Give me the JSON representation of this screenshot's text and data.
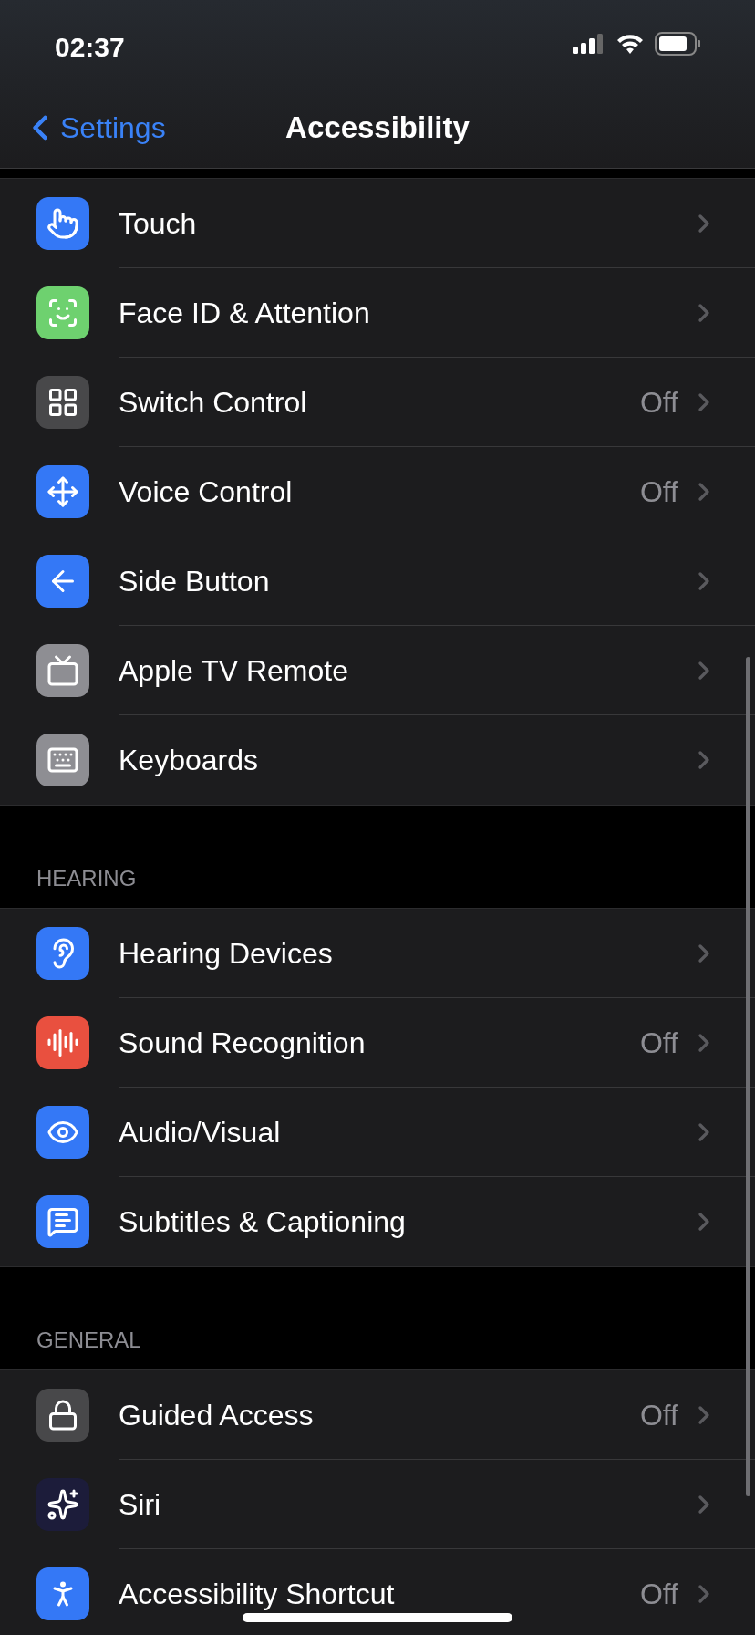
{
  "status_bar": {
    "time": "02:37"
  },
  "nav": {
    "back": "Settings",
    "title": "Accessibility"
  },
  "sections": [
    {
      "items": [
        {
          "label": "Touch",
          "color": "#3478f6"
        },
        {
          "label": "Face ID & Attention",
          "color": "#6ed16f"
        },
        {
          "label": "Switch Control",
          "value": "Off",
          "color": "#48484a"
        },
        {
          "label": "Voice Control",
          "value": "Off",
          "color": "#3478f6"
        },
        {
          "label": "Side Button",
          "color": "#3478f6"
        },
        {
          "label": "Apple TV Remote",
          "color": "#8e8e93"
        },
        {
          "label": "Keyboards",
          "color": "#8e8e93"
        }
      ]
    },
    {
      "header": "HEARING",
      "items": [
        {
          "label": "Hearing Devices",
          "color": "#3478f6"
        },
        {
          "label": "Sound Recognition",
          "value": "Off",
          "color": "#e9503f"
        },
        {
          "label": "Audio/Visual",
          "color": "#3478f6"
        },
        {
          "label": "Subtitles & Captioning",
          "color": "#3478f6"
        }
      ]
    },
    {
      "header": "GENERAL",
      "items": [
        {
          "label": "Guided Access",
          "value": "Off",
          "color": "#48484a"
        },
        {
          "label": "Siri",
          "color": "#1c1c3a"
        },
        {
          "label": "Accessibility Shortcut",
          "value": "Off",
          "color": "#3478f6"
        }
      ]
    }
  ]
}
